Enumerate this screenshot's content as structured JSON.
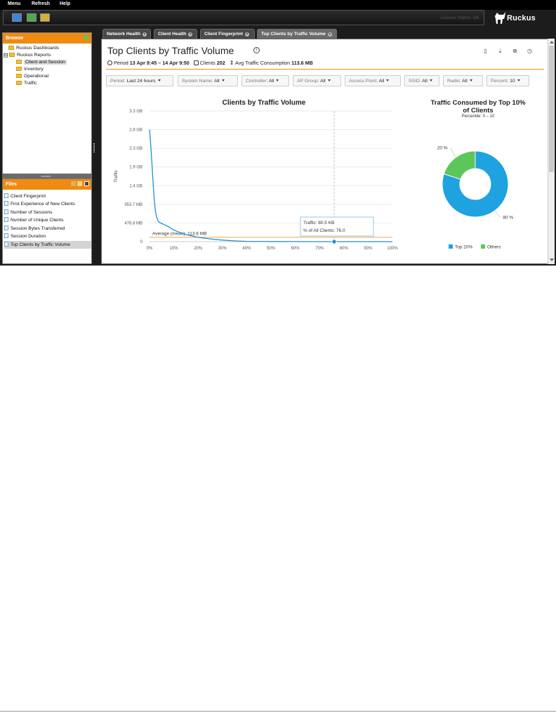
{
  "menu": [
    "Menu",
    "Refresh",
    "Help"
  ],
  "toolbar": {
    "license_status": "License Status: OK"
  },
  "brand": {
    "name": "Ruckus"
  },
  "browse": {
    "title": "Browse",
    "items": [
      {
        "label": "Ruckus Dashboards"
      },
      {
        "label": "Ruckus Reports",
        "expander": "⊟"
      },
      {
        "label": "Client and Session"
      },
      {
        "label": "Inventory"
      },
      {
        "label": "Operational"
      },
      {
        "label": "Traffic"
      }
    ]
  },
  "files": {
    "title": "Files",
    "items": [
      "Client Fingerprint",
      "First Experience of New Clients",
      "Number of Sessions",
      "Number of Unique Clients",
      "Session Bytes Transferred",
      "Session Duration",
      "Top Clients by Traffic Volume"
    ]
  },
  "tabs": [
    "Network Health",
    "Client Health",
    "Client Fingerprint",
    "Top Clients by Traffic Volume"
  ],
  "page": {
    "title": "Top Clients by Traffic Volume",
    "period_label": "Period",
    "period_value": "13 Apr 9:45 – 14 Apr 9:50",
    "clients_label": "Clients",
    "clients_value": "202",
    "avg_label": "Avg Traffic Consumption",
    "avg_value": "113.6 MB"
  },
  "filters": [
    {
      "label": "Period:",
      "value": "Last 24 hours"
    },
    {
      "label": "System Name:",
      "value": "All"
    },
    {
      "label": "Controller:",
      "value": "All"
    },
    {
      "label": "AP Group:",
      "value": "All"
    },
    {
      "label": "Access Point:",
      "value": "All"
    },
    {
      "label": "SSID:",
      "value": "All"
    },
    {
      "label": "Radio:",
      "value": "All"
    },
    {
      "label": "Percent:",
      "value": "10"
    }
  ],
  "chart_data": [
    {
      "type": "line",
      "title": "Clients by Traffic Volume",
      "xlabel": "",
      "ylabel": "Traffic",
      "x_ticks": [
        "0%",
        "10%",
        "20%",
        "30%",
        "40%",
        "50%",
        "60%",
        "70%",
        "80%",
        "90%",
        "100%"
      ],
      "y_ticks": [
        "0",
        "476.8 MB",
        "953.7 MB",
        "1.4 GB",
        "1.9 GB",
        "2.3 GB",
        "2.8 GB",
        "3.3 GB"
      ],
      "ylim_mb": [
        0,
        3379
      ],
      "x": [
        0,
        0.5,
        1,
        1.5,
        2,
        2.5,
        3,
        3.5,
        4,
        5,
        6,
        7,
        8,
        9,
        10,
        12,
        14,
        16,
        18,
        20,
        25,
        30,
        35,
        40,
        50,
        60,
        70,
        76,
        80,
        90,
        100
      ],
      "y_mb": [
        2900,
        2500,
        2000,
        1500,
        1050,
        750,
        620,
        540,
        500,
        470,
        440,
        410,
        380,
        340,
        300,
        250,
        200,
        170,
        140,
        110,
        70,
        40,
        20,
        8,
        3,
        1.5,
        0.6,
        0.08,
        0.05,
        0.02,
        0.01
      ],
      "reference_line": {
        "label": "Average (mean): 113.6 MB",
        "value_mb": 113.6
      },
      "crosshair_x": 76,
      "tooltip": {
        "line1": "Traffic: 80.5 KB",
        "line2": "% of All Clients: 76.0"
      },
      "grid": true,
      "series_color": "#1f8fd6"
    },
    {
      "type": "pie",
      "title_line1": "Traffic Consumed by Top 10%",
      "title_line2": "of Clients",
      "subtitle": "Percentile: 0 – 10",
      "slices": [
        {
          "name": "Top 10%",
          "value": 80,
          "label": "80 %",
          "color": "#1fa2e0"
        },
        {
          "name": "Others",
          "value": 20,
          "label": "20 %",
          "color": "#5cc65a"
        }
      ],
      "legend_position": "bottom"
    }
  ]
}
